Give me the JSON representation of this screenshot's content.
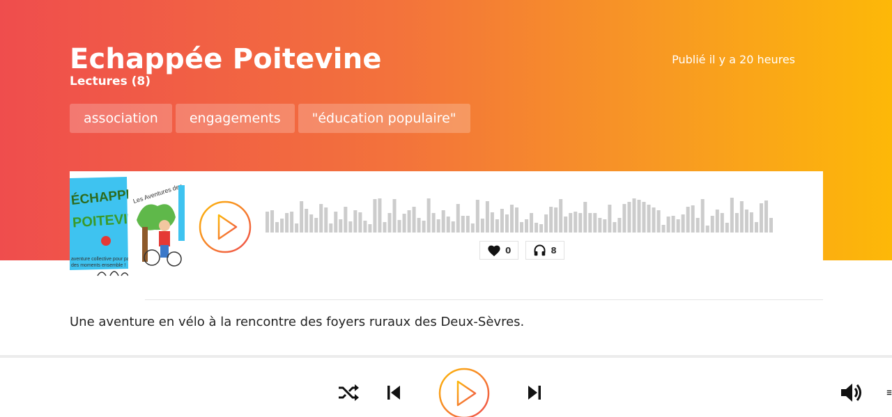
{
  "header": {
    "title": "Echappée Poitevine",
    "reads": "Lectures (8)",
    "published": "Publié il y a 20 heures"
  },
  "tags": [
    "association",
    "engagements",
    "\"éducation populaire\""
  ],
  "player": {
    "likes": "0",
    "listens": "8",
    "cover": {
      "title_text": "ÉCHAPPÉE POITEVINE",
      "caption": "aventure collective pour partager des moments ensemble !",
      "side_text": "Les aventures des foyers ruraux"
    }
  },
  "description": "Une aventure en vélo à la rencontre des foyers ruraux des Deux-Sèvres.",
  "bottom_player": {
    "controls": [
      "shuffle-icon",
      "previous-icon",
      "play-icon",
      "next-icon",
      "volume-icon",
      "playlist-icon"
    ]
  },
  "colors": {
    "gradient_start": "#ef4d4d",
    "gradient_end": "#fdb808",
    "accent_orange": "#f39221",
    "wave_grey": "#cccccc"
  }
}
